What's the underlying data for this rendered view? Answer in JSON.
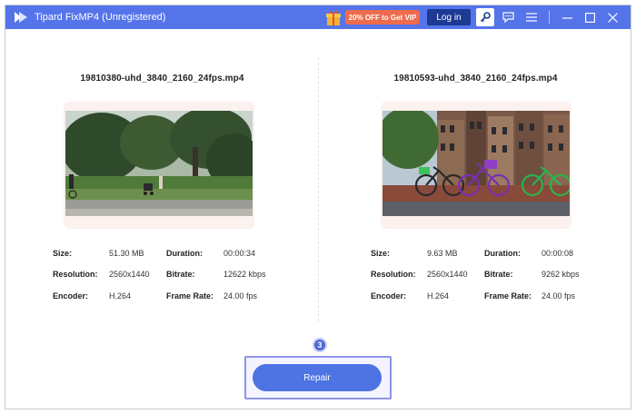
{
  "app": {
    "title": "Tipard FixMP4 (Unregistered)",
    "promo_label": "20% OFF to Get VIP",
    "login_label": "Log in",
    "accent_color": "#5574ea"
  },
  "icons": {
    "logo": "tipard-logo-icon",
    "gift": "gift-icon",
    "key": "key-icon",
    "chat": "chat-icon",
    "menu": "menu-icon",
    "minimize": "minimize-icon",
    "maximize": "maximize-icon",
    "close": "close-icon"
  },
  "left": {
    "filename": "19810380-uhd_3840_2160_24fps.mp4",
    "size_label": "Size:",
    "size_value": "51.30 MB",
    "duration_label": "Duration:",
    "duration_value": "00:00:34",
    "resolution_label": "Resolution:",
    "resolution_value": "2560x1440",
    "bitrate_label": "Bitrate:",
    "bitrate_value": "12622 kbps",
    "encoder_label": "Encoder:",
    "encoder_value": "H.264",
    "framerate_label": "Frame Rate:",
    "framerate_value": "24.00 fps"
  },
  "right": {
    "filename": "19810593-uhd_3840_2160_24fps.mp4",
    "size_label": "Size:",
    "size_value": "9.63 MB",
    "duration_label": "Duration:",
    "duration_value": "00:00:08",
    "resolution_label": "Resolution:",
    "resolution_value": "2560x1440",
    "bitrate_label": "Bitrate:",
    "bitrate_value": "9262 kbps",
    "encoder_label": "Encoder:",
    "encoder_value": "H.264",
    "framerate_label": "Frame Rate:",
    "framerate_value": "24.00 fps"
  },
  "step_number": "3",
  "repair_label": "Repair"
}
